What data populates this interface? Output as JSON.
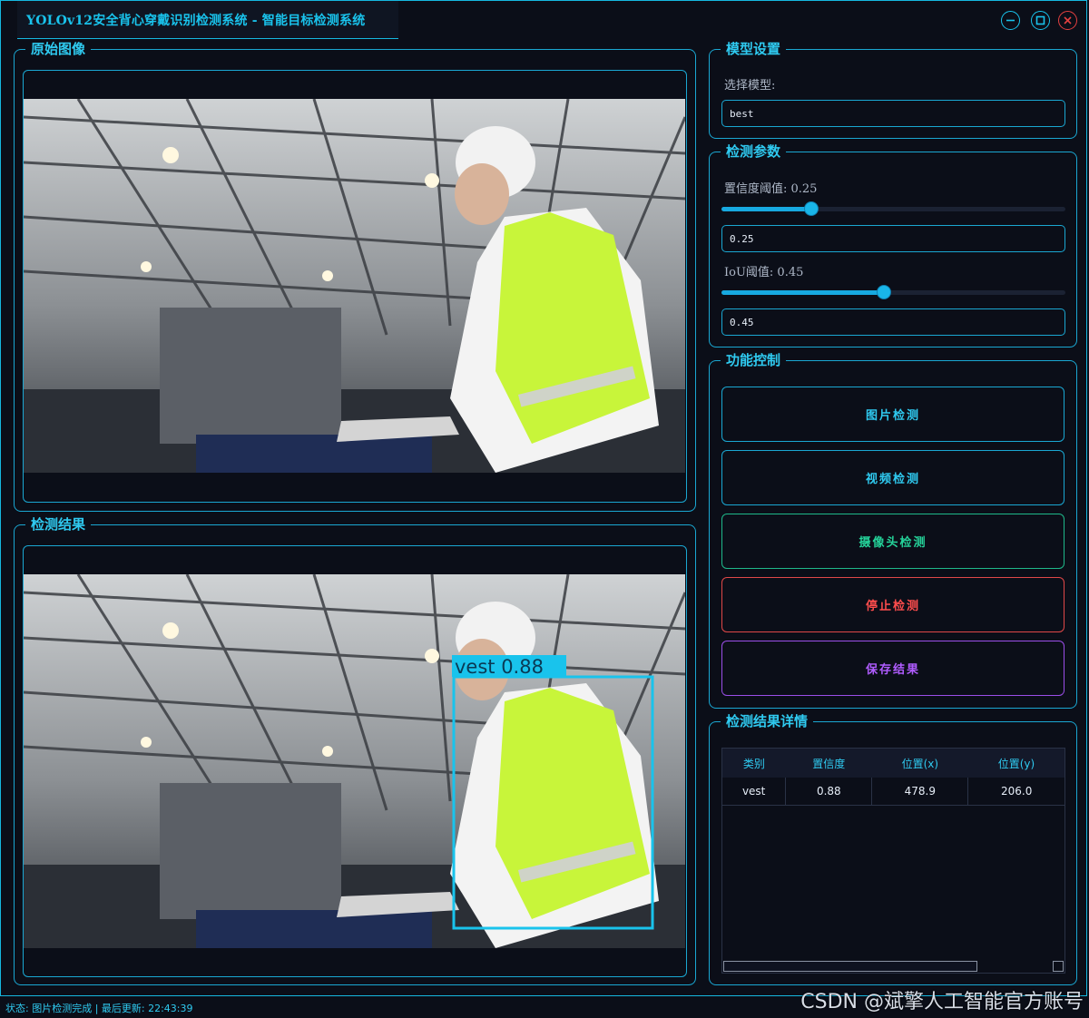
{
  "window": {
    "title": "YOLOv12安全背心穿戴识别检测系统 - 智能目标检测系统",
    "buttons": [
      "minimize-icon",
      "maximize-icon",
      "close-icon"
    ]
  },
  "panels": {
    "original": {
      "title": "原始图像"
    },
    "result": {
      "title": "检测结果",
      "box_label": "vest 0.88",
      "box_color": "#19c3ec"
    }
  },
  "model_settings": {
    "title": "模型设置",
    "select_label": "选择模型:",
    "model_value": "best"
  },
  "params": {
    "title": "检测参数",
    "conf_label": "置信度阈值: 0.25",
    "conf_value": "0.25",
    "conf_level": 0.25,
    "iou_label": "IoU阈值: 0.45",
    "iou_value": "0.45",
    "iou_level": 0.45
  },
  "controls": {
    "title": "功能控制",
    "image_detect": "图片检测",
    "video_detect": "视频检测",
    "camera_detect": "摄像头检测",
    "stop_detect": "停止检测",
    "save_result": "保存结果",
    "colors": {
      "image": "#2fcaf0",
      "video": "#2fcaf0",
      "camera": "#25d39a",
      "stop": "#ff4d4d",
      "save": "#b05cff"
    }
  },
  "details": {
    "title": "检测结果详情",
    "columns": [
      "类别",
      "置信度",
      "位置(x)",
      "位置(y)"
    ],
    "rows": [
      {
        "cls": "vest",
        "conf": "0.88",
        "x": "478.9",
        "y": "206.0"
      }
    ]
  },
  "status": {
    "text": "状态: 图片检测完成 | 最后更新: 22:43:39"
  },
  "watermark": "CSDN @斌擎人工智能官方账号"
}
